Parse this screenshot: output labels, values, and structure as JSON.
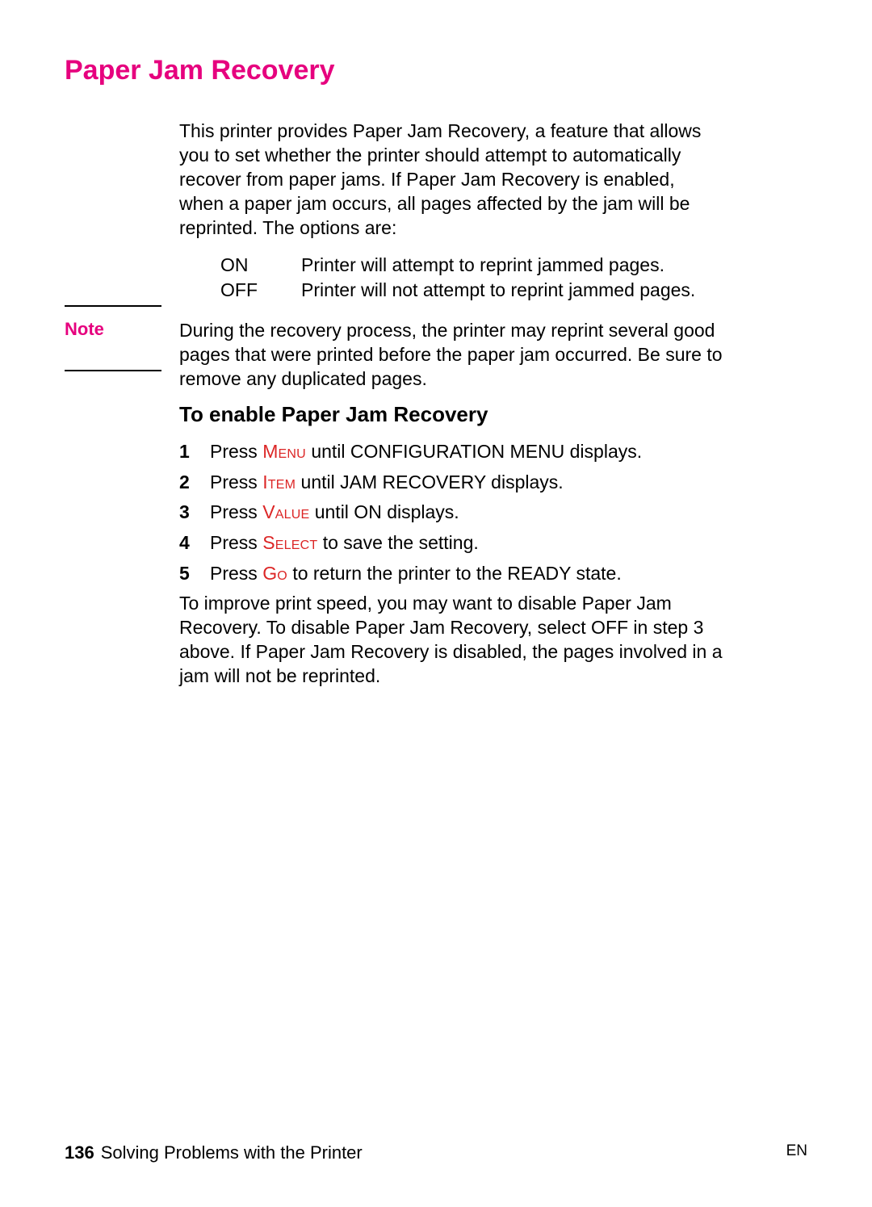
{
  "title": "Paper Jam Recovery",
  "intro": "This printer provides Paper Jam Recovery, a feature that allows you to set whether the printer should attempt to automatically recover from paper jams. If Paper Jam Recovery is enabled, when a paper jam occurs, all pages affected by the jam will be reprinted. The options are:",
  "options": {
    "on": {
      "label": "ON",
      "desc": "Printer will attempt to reprint jammed pages."
    },
    "off": {
      "label": "OFF",
      "desc": "Printer will not attempt to reprint jammed pages."
    }
  },
  "note": {
    "label": "Note",
    "text": "During the recovery process, the printer may reprint several good pages that were printed before the paper jam occurred. Be sure to remove any duplicated pages."
  },
  "section_heading": "To enable Paper Jam Recovery",
  "steps": [
    {
      "num": "1",
      "pre": "Press ",
      "key": "Menu",
      "post": " until CONFIGURATION MENU displays."
    },
    {
      "num": "2",
      "pre": "Press ",
      "key": "Item",
      "post": " until JAM RECOVERY displays."
    },
    {
      "num": "3",
      "pre": "Press ",
      "key": "Value",
      "post": " until ON displays."
    },
    {
      "num": "4",
      "pre": "Press ",
      "key": "Select",
      "post": " to save the setting."
    },
    {
      "num": "5",
      "pre": "Press ",
      "key": "Go",
      "post": " to return the printer to the READY state."
    }
  ],
  "closing": "To improve print speed, you may want to disable Paper Jam Recovery. To disable Paper Jam Recovery, select OFF in step 3 above. If Paper Jam Recovery is disabled, the pages involved in a jam will not be reprinted.",
  "footer": {
    "page_num": "136",
    "section": "Solving Problems with the Printer",
    "lang": "EN"
  }
}
